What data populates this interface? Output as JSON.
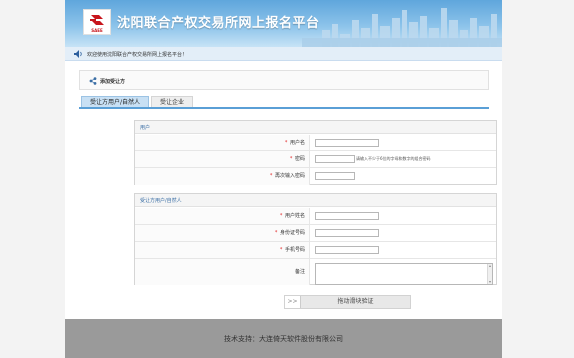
{
  "header": {
    "site_title": "沈阳联合产权交易所网上报名平台",
    "logo_text": "SAEE"
  },
  "welcome": {
    "message": "欢迎使用沈阳联合产权交易所网上报名平台！"
  },
  "panel": {
    "title": "添加受让方"
  },
  "tabs": [
    {
      "label": "受让方用户/自然人",
      "active": true
    },
    {
      "label": "受让企业",
      "active": false
    }
  ],
  "user_section": {
    "title": "用户",
    "fields": [
      {
        "label": "用户名",
        "required": true,
        "value": ""
      },
      {
        "label": "密码",
        "required": true,
        "value": "",
        "hint": "请输入不少于6位的字母和数字的组合密码"
      },
      {
        "label": "再次输入密码",
        "required": true,
        "value": ""
      }
    ]
  },
  "person_section": {
    "title": "受让方用户/自然人",
    "fields": [
      {
        "label": "用户姓名",
        "required": true,
        "value": ""
      },
      {
        "label": "身份证号码",
        "required": true,
        "value": ""
      },
      {
        "label": "手机号码",
        "required": true,
        "value": ""
      },
      {
        "label": "备注",
        "required": false,
        "value": ""
      }
    ]
  },
  "slider": {
    "handle": ">>",
    "label": "拖动滑块验证"
  },
  "footer": {
    "text": "技术支持：大连倚天软件股份有限公司"
  },
  "colors": {
    "accent": "#5a9fd6",
    "required_star": "#e02222",
    "footer_bg": "#9a9a9a"
  }
}
